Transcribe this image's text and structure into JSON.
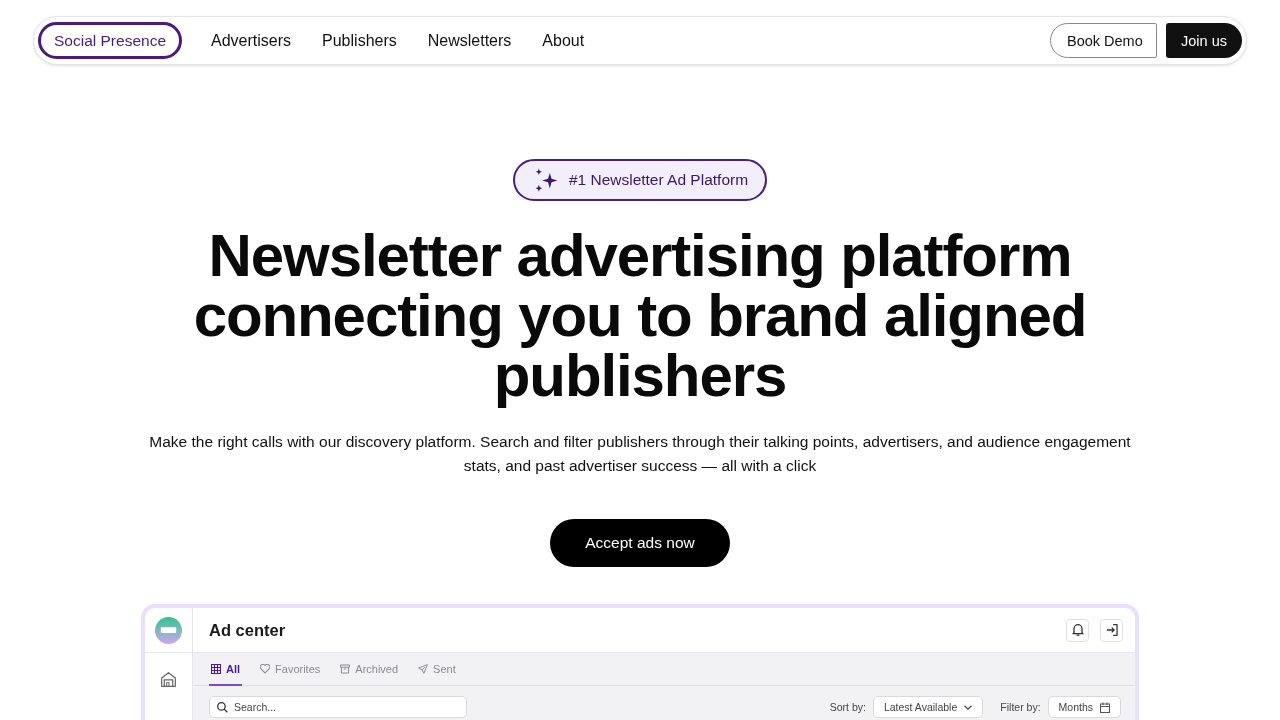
{
  "nav": {
    "brand": "Social Presence",
    "links": [
      "Advertisers",
      "Publishers",
      "Newsletters",
      "About"
    ],
    "buttons": [
      {
        "label": "Book Demo",
        "kind": "outline"
      },
      {
        "label": "Join us",
        "kind": "solid"
      }
    ]
  },
  "hero": {
    "badge": "#1 Newsletter Ad Platform",
    "headline": "Newsletter advertising platform connecting you to brand aligned publishers",
    "subtitle": "Make the right calls with our discovery platform. Search and filter publishers through their talking points, advertisers, and audience engagement stats, and past advertiser success — all with a click",
    "cta": "Accept ads now"
  },
  "dashboard": {
    "title": "Ad center",
    "tabs": [
      {
        "label": "All",
        "selected": true
      },
      {
        "label": "Favorites",
        "selected": false
      },
      {
        "label": "Archived",
        "selected": false
      },
      {
        "label": "Sent",
        "selected": false
      }
    ],
    "search": {
      "placeholder": "Search..."
    },
    "sort": {
      "label": "Sort by:",
      "value": "Latest Available"
    },
    "filter": {
      "label": "Filter by:",
      "value": "Months"
    }
  }
}
